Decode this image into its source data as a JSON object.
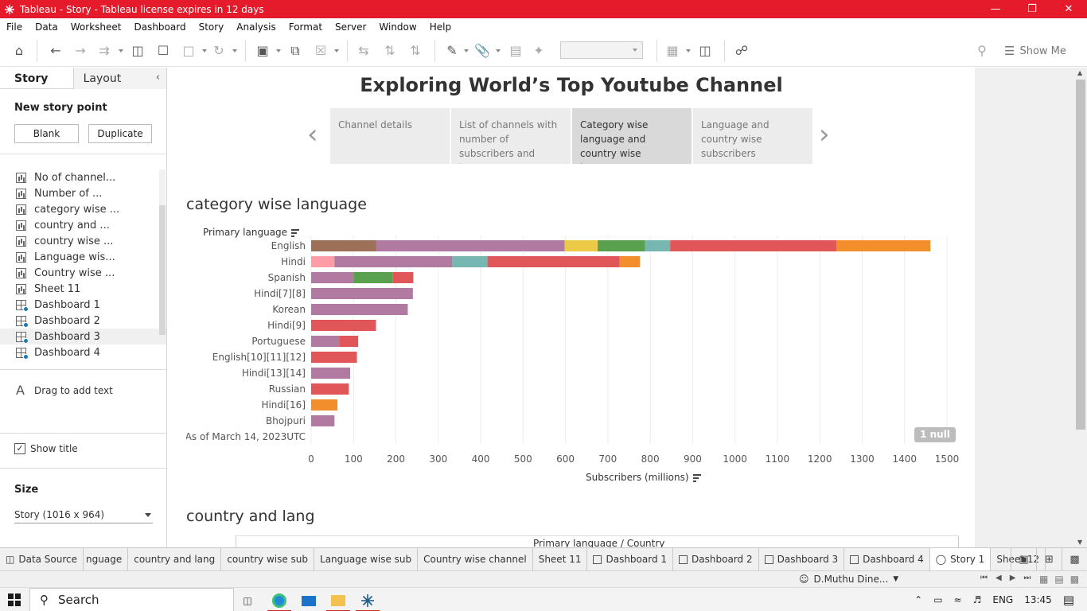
{
  "window": {
    "title": "Tableau - Story - Tableau license expires in 12 days",
    "controls": [
      "minimize-icon",
      "restore-icon",
      "close-icon"
    ]
  },
  "menu": [
    "File",
    "Data",
    "Worksheet",
    "Dashboard",
    "Story",
    "Analysis",
    "Format",
    "Server",
    "Window",
    "Help"
  ],
  "toolbar": {
    "show_me": "Show Me"
  },
  "left_panel": {
    "tab_story": "Story",
    "tab_layout": "Layout",
    "new_story_point": "New story point",
    "blank_button": "Blank",
    "duplicate_button": "Duplicate",
    "sheets": [
      {
        "label": "No of channel...",
        "type": "worksheet"
      },
      {
        "label": "Number of ...",
        "type": "worksheet"
      },
      {
        "label": "category wise ...",
        "type": "worksheet"
      },
      {
        "label": "country and ...",
        "type": "worksheet"
      },
      {
        "label": "country wise ...",
        "type": "worksheet"
      },
      {
        "label": "Language wis...",
        "type": "worksheet"
      },
      {
        "label": "Country wise ...",
        "type": "worksheet"
      },
      {
        "label": "Sheet 11",
        "type": "worksheet"
      },
      {
        "label": "Dashboard 1",
        "type": "dashboard"
      },
      {
        "label": "Dashboard 2",
        "type": "dashboard"
      },
      {
        "label": "Dashboard 3",
        "type": "dashboard"
      },
      {
        "label": "Dashboard 4",
        "type": "dashboard"
      }
    ],
    "drag_text": "Drag to add text",
    "show_title": "Show title",
    "size_label": "Size",
    "size_value": "Story (1016 x 964)"
  },
  "story": {
    "title": "Exploring World’s Top Youtube Channel",
    "points": [
      "Channel details",
      "List of channels with number of subscribers and language",
      "Category wise language and country wise language",
      "Language and country wise subscribers"
    ],
    "active_point": 2
  },
  "worksheet1": {
    "title": "category wise language",
    "row_header": "Primary language",
    "x_axis_title": "Subscribers (millions)",
    "null_badge": "1 null"
  },
  "worksheet2": {
    "title": "country and lang",
    "header": "Primary language  /  Country"
  },
  "chart_data": {
    "type": "bar",
    "stacked": true,
    "orientation": "horizontal",
    "xlabel": "Subscribers (millions)",
    "ylabel": "Primary language",
    "xlim": [
      0,
      1500
    ],
    "xticks": [
      0,
      100,
      200,
      300,
      400,
      500,
      600,
      700,
      800,
      900,
      1000,
      1100,
      1200,
      1300,
      1400,
      1500
    ],
    "grid": true,
    "categories": [
      "English",
      "Hindi",
      "Spanish",
      "Hindi[7][8]",
      "Korean",
      "Hindi[9]",
      "Portuguese",
      "English[10][11][12]",
      "Hindi[13][14]",
      "Russian",
      "Hindi[16]",
      "Bhojpuri",
      "As of March 14, 2023UTC"
    ],
    "colors": {
      "brown": "#9c7157",
      "purple": "#b07aa1",
      "yellow": "#edc948",
      "green": "#59a14f",
      "teal": "#76b7b2",
      "red": "#e15759",
      "orange": "#f28e2b",
      "pink": "#ff9da7"
    },
    "stacks": [
      [
        {
          "color": "brown",
          "value": 153
        },
        {
          "color": "purple",
          "value": 445
        },
        {
          "color": "yellow",
          "value": 78
        },
        {
          "color": "green",
          "value": 112
        },
        {
          "color": "teal",
          "value": 59
        },
        {
          "color": "red",
          "value": 392
        },
        {
          "color": "orange",
          "value": 222
        }
      ],
      [
        {
          "color": "pink",
          "value": 55
        },
        {
          "color": "purple",
          "value": 278
        },
        {
          "color": "teal",
          "value": 83
        },
        {
          "color": "red",
          "value": 312
        },
        {
          "color": "orange",
          "value": 48
        }
      ],
      [
        {
          "color": "purple",
          "value": 100
        },
        {
          "color": "green",
          "value": 93
        },
        {
          "color": "red",
          "value": 48
        }
      ],
      [
        {
          "color": "purple",
          "value": 240
        }
      ],
      [
        {
          "color": "purple",
          "value": 228
        }
      ],
      [
        {
          "color": "red",
          "value": 153
        }
      ],
      [
        {
          "color": "purple",
          "value": 66
        },
        {
          "color": "red",
          "value": 45
        }
      ],
      [
        {
          "color": "red",
          "value": 108
        }
      ],
      [
        {
          "color": "purple",
          "value": 92
        }
      ],
      [
        {
          "color": "red",
          "value": 89
        }
      ],
      [
        {
          "color": "orange",
          "value": 62
        }
      ],
      [
        {
          "color": "purple",
          "value": 55
        }
      ],
      []
    ]
  },
  "bottom_tabs": [
    {
      "label": "Data Source",
      "icon": "database-icon",
      "active": false
    },
    {
      "label": "nguage",
      "icon": "",
      "active": false
    },
    {
      "label": "country and lang",
      "icon": "",
      "active": false
    },
    {
      "label": "country wise sub",
      "icon": "",
      "active": false
    },
    {
      "label": "Language wise sub",
      "icon": "",
      "active": false
    },
    {
      "label": "Country wise channel",
      "icon": "",
      "active": false
    },
    {
      "label": "Sheet 11",
      "icon": "",
      "active": false
    },
    {
      "label": "Dashboard 1",
      "icon": "dashboard-icon",
      "active": false
    },
    {
      "label": "Dashboard 2",
      "icon": "dashboard-icon",
      "active": false
    },
    {
      "label": "Dashboard 3",
      "icon": "dashboard-icon",
      "active": false
    },
    {
      "label": "Dashboard 4",
      "icon": "dashboard-icon",
      "active": false
    },
    {
      "label": "Story 1",
      "icon": "story-icon",
      "active": true
    },
    {
      "label": "Sheet 12",
      "icon": "",
      "active": false
    }
  ],
  "status": {
    "user": "D.Muthu Dine..."
  },
  "taskbar": {
    "search": "Search",
    "lang": "ENG",
    "time": "13:45"
  }
}
